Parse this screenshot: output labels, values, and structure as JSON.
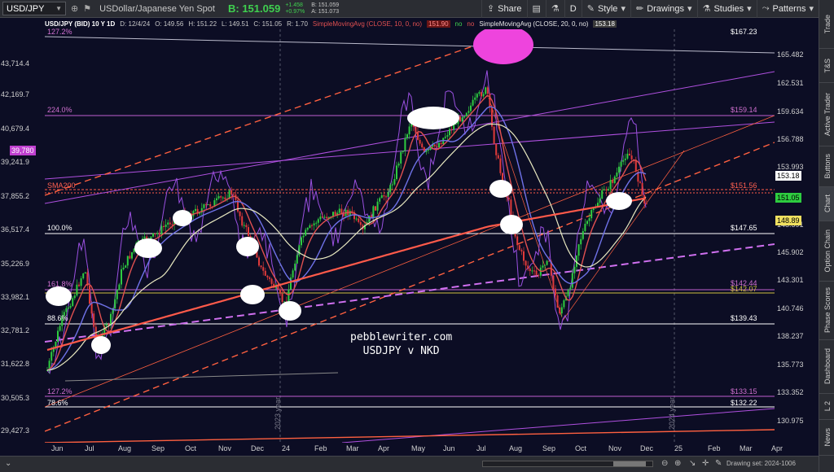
{
  "toolbar": {
    "symbol": "USD/JPY",
    "description": "USDollar/Japanese Yen Spot",
    "bid_label": "B: 151.059",
    "change_abs": "+1.458",
    "change_pct": "+0.97%",
    "bid_small": "B: 151.059",
    "ask_small": "A: 151.073",
    "share_label": "Share",
    "period_label": "D",
    "style_label": "Style",
    "drawings_label": "Drawings",
    "studies_label": "Studies",
    "patterns_label": "Patterns"
  },
  "header": {
    "symbol": "USD/JPY (BID) 10 Y 1D",
    "date": "D: 12/4/24",
    "open": "O: 149.56",
    "high": "H: 151.22",
    "low": "L: 149.51",
    "close": "C: 151.05",
    "range": "R: 1.70",
    "sma10": "SimpleMovingAvg (CLOSE, 10, 0, no)",
    "sma10_value": "151.90",
    "flag_no1": "no",
    "flag_no2": "no",
    "sma20": "SimpleMovingAvg (CLOSE, 20, 0, no)",
    "sma20_value": "153.18"
  },
  "side_tabs": [
    "Trade",
    "T&S",
    "Active Trader",
    "Buttons",
    "Chart",
    "Option Chain",
    "Phase Scores",
    "Dashboard",
    "L 2",
    "News"
  ],
  "left_axis": [
    "43,714.4",
    "42,169.7",
    "40,679.4",
    "39,241.9",
    "37,855.2",
    "36,517.4",
    "35,226.9",
    "33,982.1",
    "32,781.2",
    "31,622.8",
    "30,505.3",
    "29,427.3"
  ],
  "right_axis": [
    "165.482",
    "162.531",
    "159.634",
    "156.788",
    "153.993",
    "148.591",
    "145.902",
    "143.301",
    "140.746",
    "138.237",
    "135.773",
    "133.352",
    "130.975"
  ],
  "price_tags": {
    "nkd": "39,780",
    "sma20": "153.18",
    "last": "151.05",
    "other": "148.89"
  },
  "fib_levels": {
    "top_left": "127.2%",
    "top_right": "$167.23",
    "l224": "224.0%",
    "r159": "$159.14",
    "sma200": "SMA200",
    "r151": "$151.56",
    "l100": "100.0%",
    "r147": "$147.65",
    "l161": "161.8%",
    "r142a": "$142.44",
    "r142b": "$142.07",
    "l886": "88.6%",
    "r139": "$139.43",
    "l1272": "127.2%",
    "r133": "$133.15",
    "l786": "78.6%",
    "r132": "$132.22"
  },
  "years": [
    "2023 year",
    "2024 year"
  ],
  "months": [
    "Jun",
    "Jul",
    "Aug",
    "Sep",
    "Oct",
    "Nov",
    "Dec",
    "24",
    "Feb",
    "Mar",
    "Apr",
    "May",
    "Jun",
    "Jul",
    "Aug",
    "Sep",
    "Oct",
    "Nov",
    "Dec",
    "25",
    "Feb",
    "Mar",
    "Apr"
  ],
  "watermark": {
    "line1": "pebblewriter.com",
    "line2": "USDJPY v NKD"
  },
  "status": {
    "drawing_set": "Drawing set: 2024-1006"
  },
  "colors": {
    "background": "#0c0d24",
    "up_candle": "#2ecc40",
    "down_candle": "#e03a3a",
    "sma10": "#e05050",
    "sma200": "#ff5a4a",
    "nkd": "#9a50e0",
    "fib_pink": "#d070d0"
  }
}
